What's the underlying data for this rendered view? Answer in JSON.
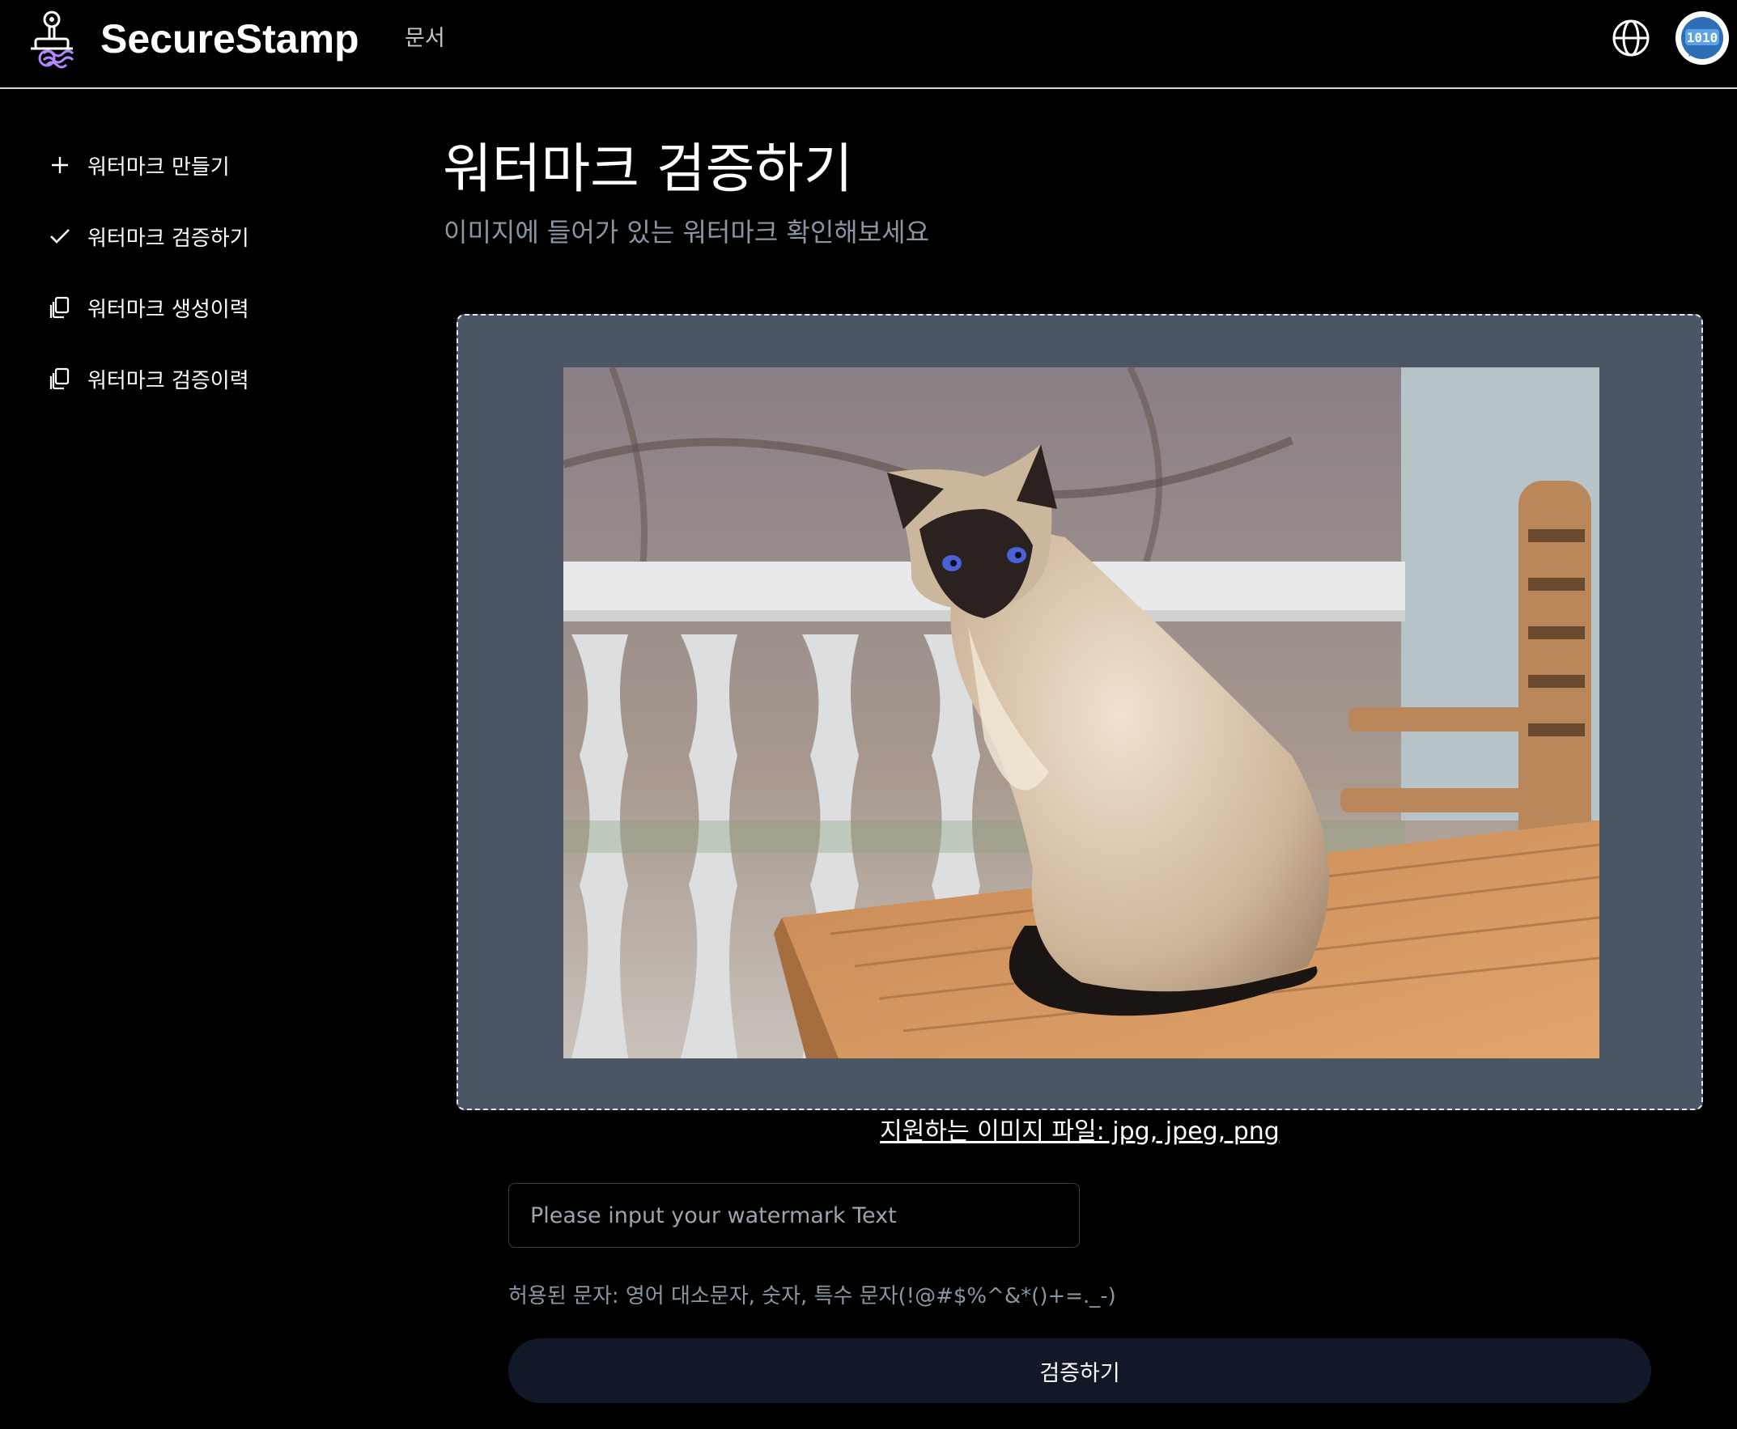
{
  "header": {
    "brand": "SecureStamp",
    "nav_docs": "문서",
    "logo_icon": "stamp-logo-icon",
    "language_icon": "globe-icon",
    "avatar_icon": "user-avatar"
  },
  "sidebar": {
    "items": [
      {
        "label": "워터마크 만들기",
        "icon": "plus-icon"
      },
      {
        "label": "워터마크 검증하기",
        "icon": "check-icon"
      },
      {
        "label": "워터마크 생성이력",
        "icon": "copy-icon"
      },
      {
        "label": "워터마크 검증이력",
        "icon": "copy-icon"
      }
    ]
  },
  "main": {
    "title": "워터마크 검증하기",
    "subtitle": "이미지에 들어가 있는 워터마크 확인해보세요",
    "dropzone": {
      "support_text": "지원하는 이미지 파일: jpg, jpeg, png",
      "preview": "uploaded-image-preview"
    },
    "watermark_input": {
      "value": "",
      "placeholder": "Please input your watermark Text"
    },
    "allowed_chars": "허용된 문자: 영어 대소문자, 숫자, 특수 문자(!@#$%^&*()+=._-)",
    "verify_button": "검증하기"
  },
  "colors": {
    "background": "#000000",
    "dropzone_bg": "#4b5563",
    "button_bg": "#111827",
    "muted_text": "#8b96a5",
    "logo_accent": "#b388ff"
  }
}
